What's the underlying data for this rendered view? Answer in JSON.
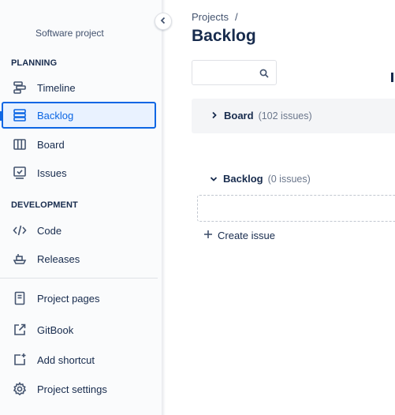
{
  "sidebar": {
    "project_name": "Software project",
    "planning_label": "PLANNING",
    "development_label": "DEVELOPMENT",
    "planning_items": [
      {
        "label": "Timeline",
        "icon": "timeline-icon"
      },
      {
        "label": "Backlog",
        "icon": "backlog-icon",
        "active": true
      },
      {
        "label": "Board",
        "icon": "board-icon"
      },
      {
        "label": "Issues",
        "icon": "issues-icon"
      }
    ],
    "development_items": [
      {
        "label": "Code",
        "icon": "code-icon"
      },
      {
        "label": "Releases",
        "icon": "releases-icon"
      }
    ],
    "bottom_items": [
      {
        "label": "Project pages",
        "icon": "project-pages-icon"
      },
      {
        "label": "GitBook",
        "icon": "external-link-icon"
      },
      {
        "label": "Add shortcut",
        "icon": "add-shortcut-icon"
      },
      {
        "label": "Project settings",
        "icon": "gear-icon"
      }
    ]
  },
  "header": {
    "breadcrumb_root": "Projects",
    "breadcrumb_separator": "/",
    "title": "Backlog"
  },
  "search": {
    "value": "",
    "placeholder": ""
  },
  "board_group": {
    "title": "Board",
    "count": "(102 issues)",
    "expanded": false
  },
  "backlog_group": {
    "title": "Backlog",
    "count": "(0 issues)",
    "expanded": true
  },
  "create_issue_label": "Create issue",
  "colors": {
    "accent": "#0c66e4",
    "text": "#172b4d",
    "subtle": "#6b778c"
  }
}
